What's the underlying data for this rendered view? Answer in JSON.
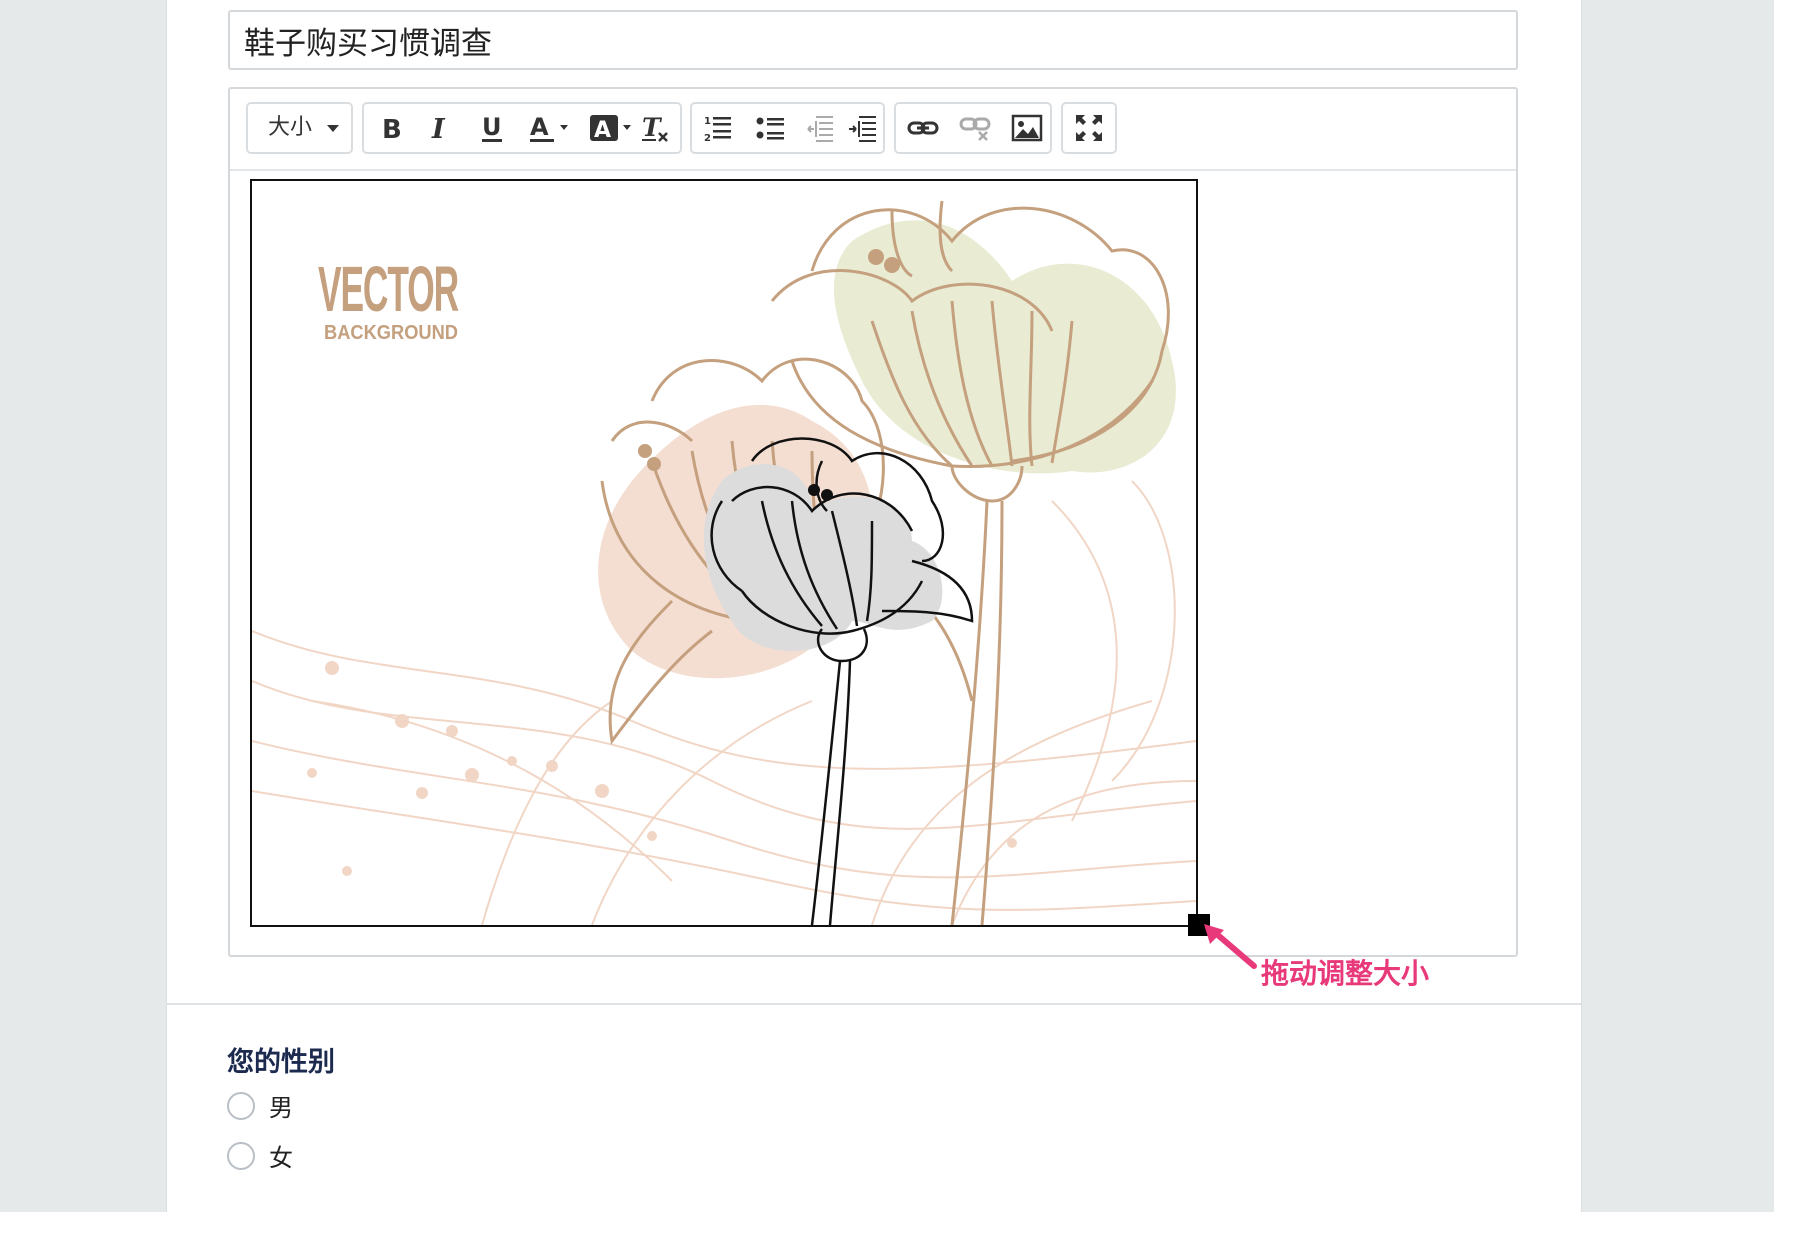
{
  "survey": {
    "title_value": "鞋子购买习惯调查"
  },
  "toolbar": {
    "size_label": "大小",
    "buttons": [
      "bold",
      "italic",
      "underline",
      "font-color",
      "background-color",
      "clear-format",
      "ordered-list",
      "unordered-list",
      "outdent",
      "indent",
      "link",
      "unlink",
      "image",
      "fullscreen"
    ]
  },
  "image": {
    "headline": "VECTOR",
    "subline": "BACKGROUND",
    "colors": {
      "brown": "#c4a07e",
      "light_green": "#e9ecd3",
      "peach": "#f1d6c6",
      "black": "#111111"
    }
  },
  "annotation": {
    "text": "拖动调整大小",
    "color": "#e8397a"
  },
  "question": {
    "title": "您的性别",
    "options": [
      {
        "label": "男"
      },
      {
        "label": "女"
      }
    ]
  }
}
